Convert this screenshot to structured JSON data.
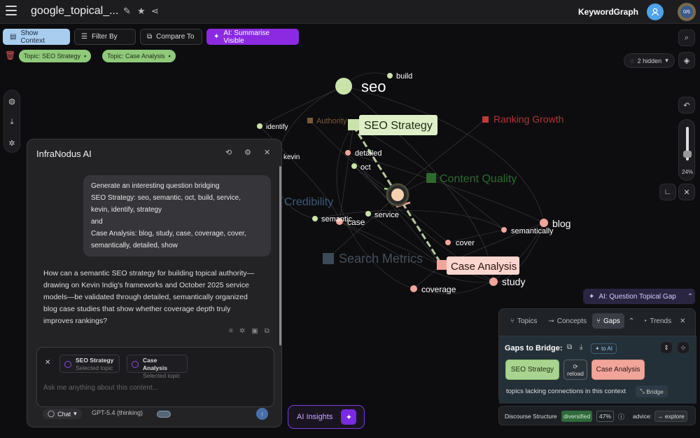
{
  "header": {
    "title": "google_topical_...",
    "brand": "KeywordGraph",
    "progress_label": "0/6"
  },
  "toolbar": {
    "show_context": "Show Context",
    "filter_by": "Filter By",
    "compare_to": "Compare To",
    "ai_summarise": "AI: Summarise Visible"
  },
  "filters": {
    "topic1": "Topic: SEO Strategy",
    "topic2": "Topic: Case Analysis"
  },
  "view": {
    "hidden_label": "2 hidden",
    "zoom": "24%"
  },
  "graph": {
    "nodes": {
      "seo": "seo",
      "build": "build",
      "identify": "identify",
      "authority": "Authority",
      "seo_strategy": "SEO Strategy",
      "ranking_growth": "Ranking Growth",
      "kevin": "kevin",
      "detailed": "detailed",
      "oct": "oct",
      "content_quality": "Content Quality",
      "credibility": "Credibility",
      "semantic": "semantic",
      "service": "service",
      "case": "case",
      "blog": "blog",
      "semantically": "semantically",
      "cover": "cover",
      "search_metrics": "Search Metrics",
      "case_analysis": "Case Analysis",
      "study": "study",
      "coverage": "coverage"
    }
  },
  "ai_panel": {
    "title": "InfraNodus AI",
    "user_message": [
      "Generate an interesting question bridging",
      "SEO Strategy: seo, semantic, oct, build, service,",
      "kevin, identify, strategy",
      "and",
      "Case Analysis: blog, study, case, coverage, cover,",
      "semantically, detailed, show"
    ],
    "assistant_message": [
      "How can a semantic SEO strategy for building topical authority—",
      "drawing on Kevin Indig's frameworks and October 2025 service",
      "models—be validated through detailed, semantically organized",
      "blog case studies that show whether coverage depth truly",
      "improves rankings?"
    ],
    "context_tags": [
      {
        "name": "SEO Strategy",
        "sub": "Selected topic"
      },
      {
        "name": "Case Analysis",
        "sub": "Selected topic"
      }
    ],
    "input_placeholder": "Ask me anything about this content...",
    "mode": "Chat",
    "model": "GPT-5.4 (thinking)"
  },
  "insights_button": "AI Insights",
  "question_gap": "AI: Question Topical Gap",
  "gaps_panel": {
    "tabs": [
      "Topics",
      "Concepts",
      "Gaps",
      "Trends"
    ],
    "title": "Gaps to Bridge:",
    "to_ai": "to AI",
    "gap_a": "SEO Strategy",
    "reload": "reload",
    "gap_b": "Case Analysis",
    "note": "topics lacking connections in this context",
    "bridge": "Bridge"
  },
  "discourse": {
    "label": "Discourse Structure",
    "status": "diversified",
    "percent": "47%",
    "advice_label": "advice:",
    "advice": "explore"
  },
  "colors": {
    "accent_purple": "#8b2ae0",
    "green_topic": "#a9d48f",
    "red_topic": "#f1a59a",
    "select_blue": "#a9cdef"
  }
}
